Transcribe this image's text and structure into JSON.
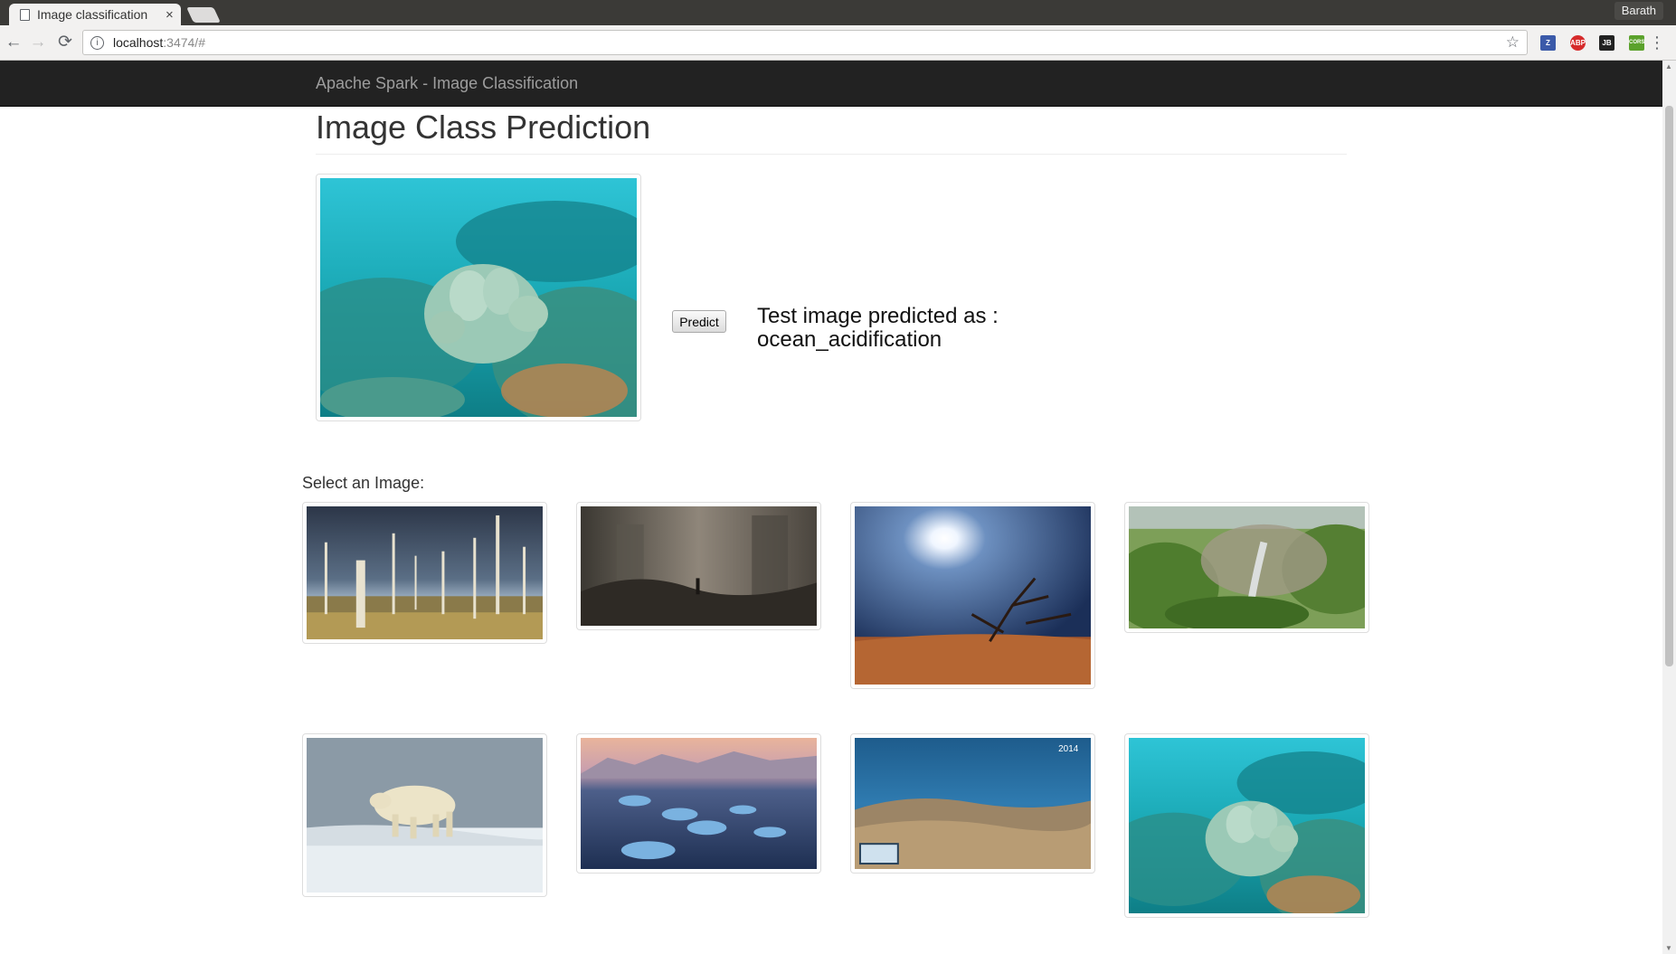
{
  "browser": {
    "tab_title": "Image classification",
    "tab_close": "×",
    "profile_name": "Barath",
    "url_host": "localhost",
    "url_rest": ":3474/#",
    "nav": {
      "back": "←",
      "forward": "→",
      "reload": "⟳"
    },
    "star": "☆",
    "menu": "⋮",
    "extensions": [
      {
        "name": "zotero-extension-icon",
        "label": "Z",
        "color": "#3b5aa9"
      },
      {
        "name": "adblock-plus-extension-icon",
        "label": "ABP",
        "color": "#d62b2b"
      },
      {
        "name": "jsonview-extension-icon",
        "label": "JB",
        "color": "#222222"
      },
      {
        "name": "cors-extension-icon",
        "label": "CORS",
        "color": "#5ba22c"
      }
    ]
  },
  "navbar": {
    "brand": "Apache Spark - Image Classification"
  },
  "main": {
    "title": "Image Class Prediction",
    "predict_button": "Predict",
    "result_line1": "Test image predicted as :",
    "result_line2": "ocean_acidification",
    "select_label": "Select an Image:",
    "gallery": [
      {
        "name": "gallery-image-dead-forest",
        "scene": "dead-forest"
      },
      {
        "name": "gallery-image-polluted-ruins",
        "scene": "ruins"
      },
      {
        "name": "gallery-image-drought-sun",
        "scene": "drought"
      },
      {
        "name": "gallery-image-deforestation-smoke",
        "scene": "deforestation"
      },
      {
        "name": "gallery-image-polar-bear",
        "scene": "polar-bear"
      },
      {
        "name": "gallery-image-melting-icebergs",
        "scene": "icebergs"
      },
      {
        "name": "gallery-image-coral-bleaching",
        "scene": "coral-2014",
        "overlay_text": "2014"
      },
      {
        "name": "gallery-image-ocean-acidification",
        "scene": "reef"
      }
    ]
  }
}
